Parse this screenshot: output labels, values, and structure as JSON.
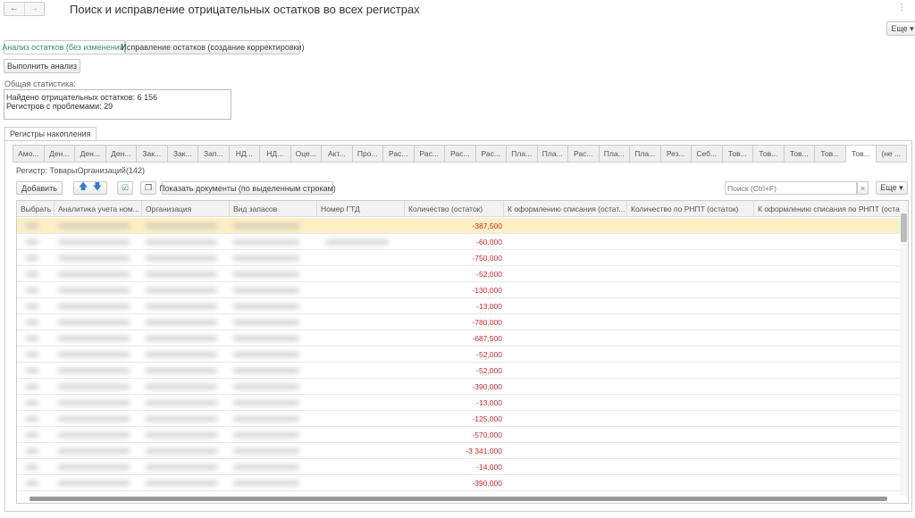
{
  "header": {
    "title": "Поиск и исправление отрицательных остатков во всех регистрах",
    "back": "←",
    "forward": "→",
    "more_label": "Еще",
    "kebab": "⋮"
  },
  "mode_tabs": [
    {
      "label": "Анализ остатков (без изменений)",
      "active": true
    },
    {
      "label": "Исправление остатков (создание корректировки)",
      "active": false
    }
  ],
  "run_button": "Выполнить анализ",
  "stats": {
    "label": "Общая статистика:",
    "line1": "Найдено отрицательных остатков: 6 156",
    "line2": "Регистров с проблемами: 29"
  },
  "group_tab": "Регистры накопления",
  "register_tabs": [
    "Амо...",
    "Ден...",
    "Ден...",
    "Ден...",
    "Зак...",
    "Зак...",
    "Зап...",
    "НД...",
    "НД...",
    "Оце...",
    "Акт...",
    "Про...",
    "Рас...",
    "Рас...",
    "Рас...",
    "Рас...",
    "Пла...",
    "Пла...",
    "Рас...",
    "Пла...",
    "Пла...",
    "Рез...",
    "Себ...",
    "Тов...",
    "Тов...",
    "Тов...",
    "Тов...",
    "Тов...",
    "(не ..."
  ],
  "active_register_tab": 27,
  "register_label": "Регистр: ТоварыОрганизаций(142)",
  "toolbar": {
    "add": "Добавить",
    "show_docs": "Показать документы (по выделенным строкам)",
    "search_placeholder": "Поиск (Ctrl+F)",
    "clear": "×",
    "more": "Еще ▾"
  },
  "columns": [
    "Выбрать",
    "Аналитика учета ном...",
    "Организация",
    "Вид запасов",
    "Номер ГТД",
    "Количество (остаток)",
    "К оформлению списания (остат...",
    "Количество по РНПТ (остаток)",
    "К оформлению списания по РНПТ (остат..."
  ],
  "rows": [
    "-387,500",
    "-60,000",
    "-750,000",
    "-52,000",
    "-130,000",
    "-13,000",
    "-780,000",
    "-687,500",
    "-52,000",
    "-52,000",
    "-390,000",
    "-13,000",
    "-125,000",
    "-570,000",
    "-3 341,000",
    "-14,000",
    "-390,000"
  ],
  "colors": {
    "accent_green": "#2e9a4a",
    "negative": "#d22222",
    "selected_row": "#fbf0c4"
  }
}
